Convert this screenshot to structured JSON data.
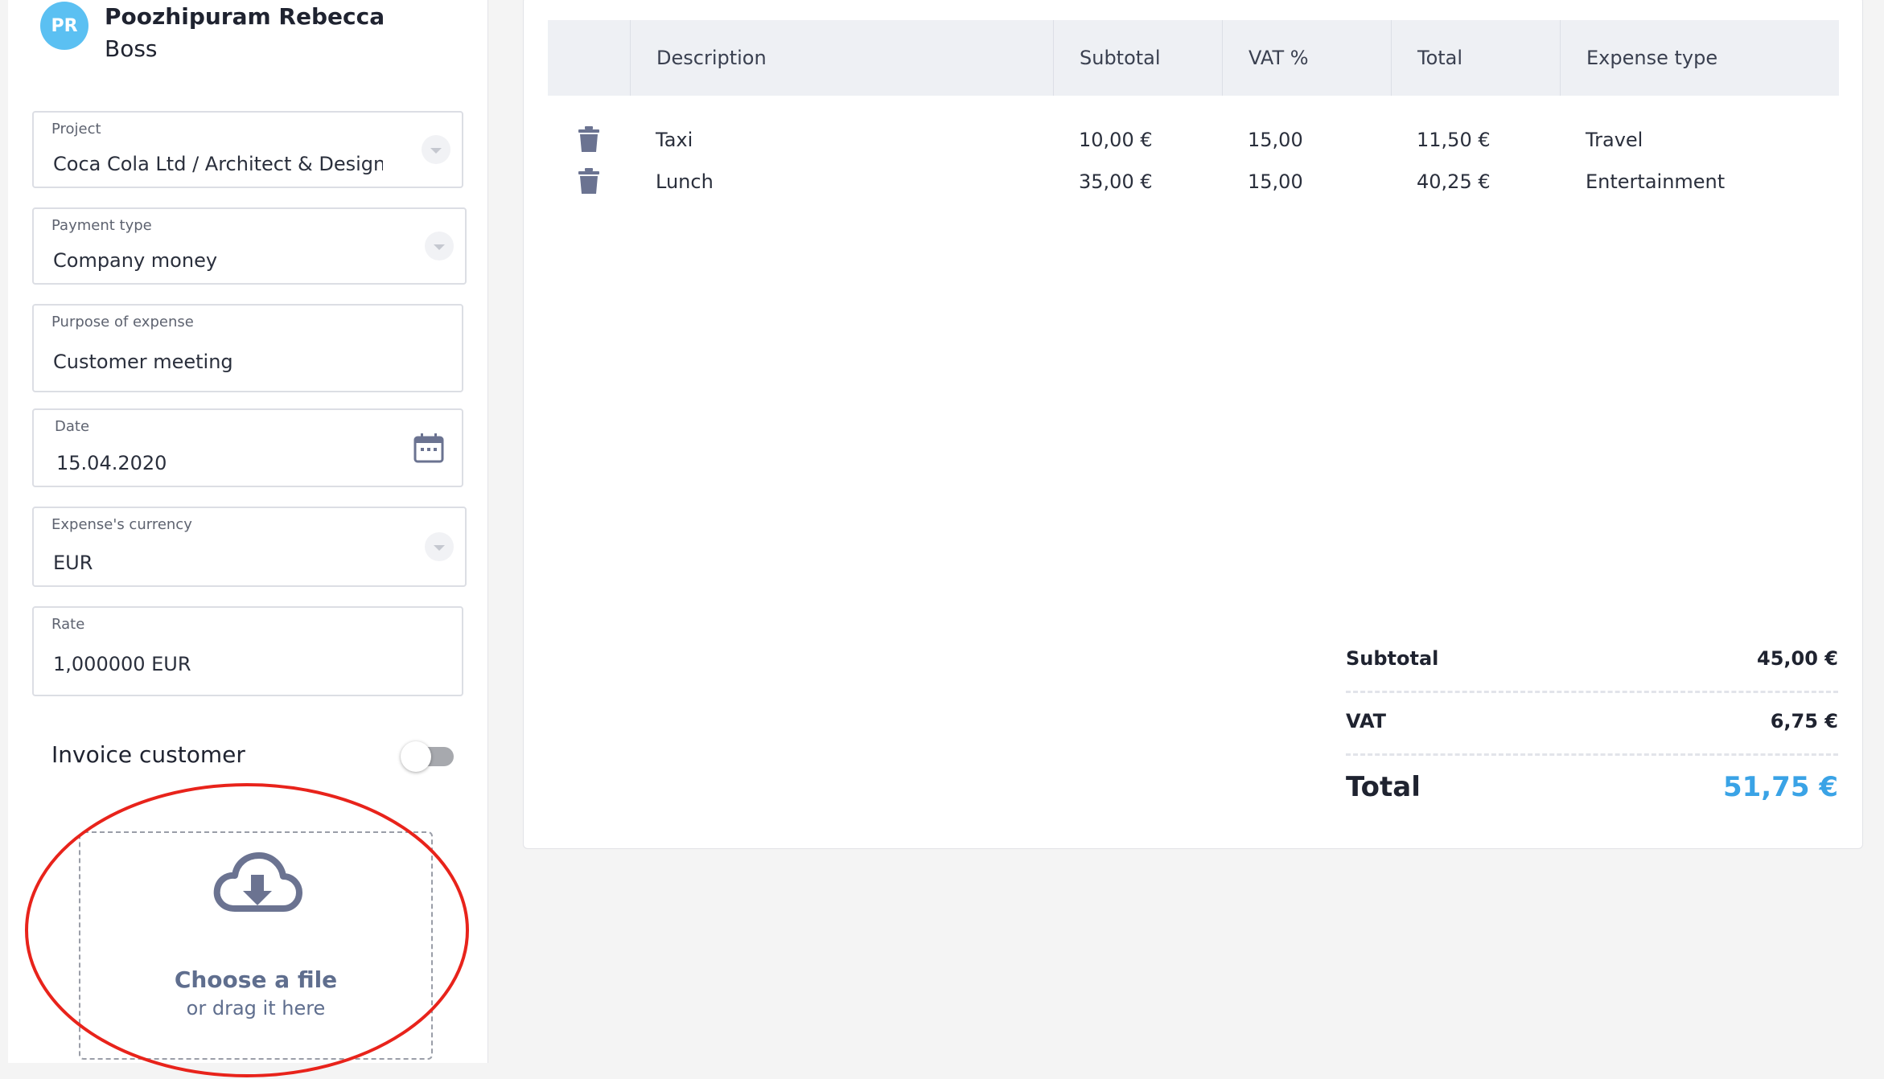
{
  "user": {
    "initials": "PR",
    "name": "Poozhipuram Rebecca",
    "role": "Boss",
    "avatar_color": "#5bc0f2"
  },
  "form": {
    "project": {
      "label": "Project",
      "value": "Coca Cola Ltd / Architect & Design ("
    },
    "payment_type": {
      "label": "Payment type",
      "value": "Company money"
    },
    "purpose": {
      "label": "Purpose of expense",
      "value": "Customer meeting"
    },
    "date": {
      "label": "Date",
      "value": "15.04.2020"
    },
    "currency": {
      "label": "Expense's currency",
      "value": "EUR"
    },
    "rate": {
      "label": "Rate",
      "value": "1,000000 EUR"
    },
    "invoice_customer": {
      "label": "Invoice customer",
      "enabled": false
    }
  },
  "upload": {
    "title": "Choose a file",
    "subtitle": "or drag it here",
    "icon": "cloud-upload-icon"
  },
  "table": {
    "columns": [
      "Description",
      "Subtotal",
      "VAT %",
      "Total",
      "Expense type"
    ],
    "rows": [
      {
        "description": "Taxi",
        "subtotal": "10,00 €",
        "vat": "15,00",
        "total": "11,50 €",
        "type": "Travel"
      },
      {
        "description": "Lunch",
        "subtotal": "35,00 €",
        "vat": "15,00",
        "total": "40,25 €",
        "type": "Entertainment"
      }
    ]
  },
  "summary": {
    "subtotal_label": "Subtotal",
    "subtotal_value": "45,00 €",
    "vat_label": "VAT",
    "vat_value": "6,75 €",
    "total_label": "Total",
    "total_value": "51,75 €",
    "total_color": "#3aa3e6"
  },
  "colors": {
    "annotation": "#e8231b",
    "icon": "#6b7391"
  }
}
